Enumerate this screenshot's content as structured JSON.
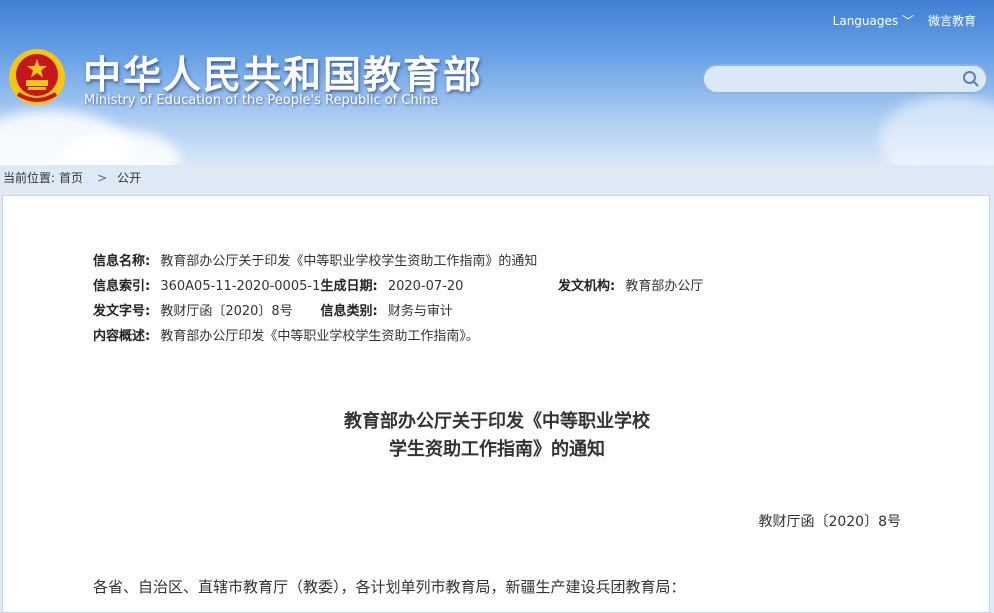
{
  "header": {
    "site_title": "中华人民共和国教育部",
    "site_subtitle": "Ministry of Education of the People's Republic of China",
    "languages_label": "Languages",
    "weibo_label": "微言教育",
    "search_placeholder": ""
  },
  "breadcrumb": {
    "prefix": "当前位置:",
    "home": "首页",
    "current": "公开"
  },
  "info": {
    "name_label": "信息名称:",
    "name_value": "教育部办公厅关于印发《中等职业学校学生资助工作指南》的通知",
    "index_label": "信息索引:",
    "index_value": "360A05-11-2020-0005-1",
    "date_label": "生成日期:",
    "date_value": "2020-07-20",
    "org_label": "发文机构:",
    "org_value": "教育部办公厅",
    "docno_label": "发文字号:",
    "docno_value": "教财厅函〔2020〕8号",
    "category_label": "信息类别:",
    "category_value": "财务与审计",
    "summary_label": "内容概述:",
    "summary_value": "教育部办公厅印发《中等职业学校学生资助工作指南》。"
  },
  "document": {
    "title_line1": "教育部办公厅关于印发《中等职业学校",
    "title_line2": "学生资助工作指南》的通知",
    "doc_number": "教财厅函〔2020〕8号",
    "salutation": "各省、自治区、直辖市教育厅（教委），各计划单列市教育局，新疆生产建设兵团教育局："
  },
  "colors": {
    "header_top": "#3f7fd4",
    "header_bottom": "#d9e7f8",
    "emblem_red": "#c8161d",
    "emblem_gold": "#f5c518"
  }
}
